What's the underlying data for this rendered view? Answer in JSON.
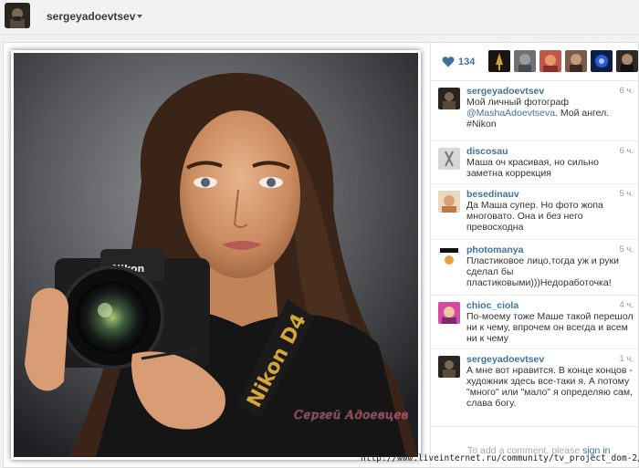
{
  "header": {
    "username": "sergeyadoevtsev",
    "avatar_icon": "profile-avatar-icon",
    "dropdown_icon": "chevron-down-icon"
  },
  "post": {
    "photo_subject": "woman-with-nikon-d4-camera",
    "watermark": "Сергей Адоевцев",
    "likes": {
      "icon": "heart-icon",
      "count": "134",
      "liker_avatars": [
        "liker-1",
        "liker-2",
        "liker-3",
        "liker-4",
        "liker-5",
        "liker-6"
      ]
    },
    "comments": [
      {
        "user": "sergeyadoevtsev",
        "time": "6 ч.",
        "text_before": "Мой личный фотограф ",
        "mention": "@MashaAdoevtseva",
        "text_after": ". Мой ангел. #Nikon"
      },
      {
        "user": "discosau",
        "time": "6 ч.",
        "text": "Маша оч красивая, но сильно заметна коррекция"
      },
      {
        "user": "besedinauv",
        "time": "5 ч.",
        "text": "Да Маша супер. Но фото жопа многовато. Она и без него превосходна"
      },
      {
        "user": "photomanya",
        "time": "5 ч.",
        "text": "Пластиковое лицо,тогда уж и руки сделал бы пластиковыми)))Недоработочка!"
      },
      {
        "user": "chioc_ciola",
        "time": "4 ч.",
        "text": "По-моему тоже Маше такой перешол ни к чему, впрочем он всегда и всем ни к чему"
      },
      {
        "user": "sergeyadoevtsev",
        "time": "1 ч.",
        "text": "А мне вот нравится. В конце концов - художник здесь все-таки я. А потому \"много\" или \"мало\" я определяю сам, слава богу."
      }
    ],
    "add_comment": {
      "prefix": "To add a comment, please ",
      "link": "sign in"
    }
  },
  "url_overlay": "http://www.liveinternet.ru/community/tv_project_dom-2/",
  "colors": {
    "link_blue": "#3f729b",
    "watermark_red": "#b52c4d",
    "header_bg": "#f2f2f2"
  }
}
